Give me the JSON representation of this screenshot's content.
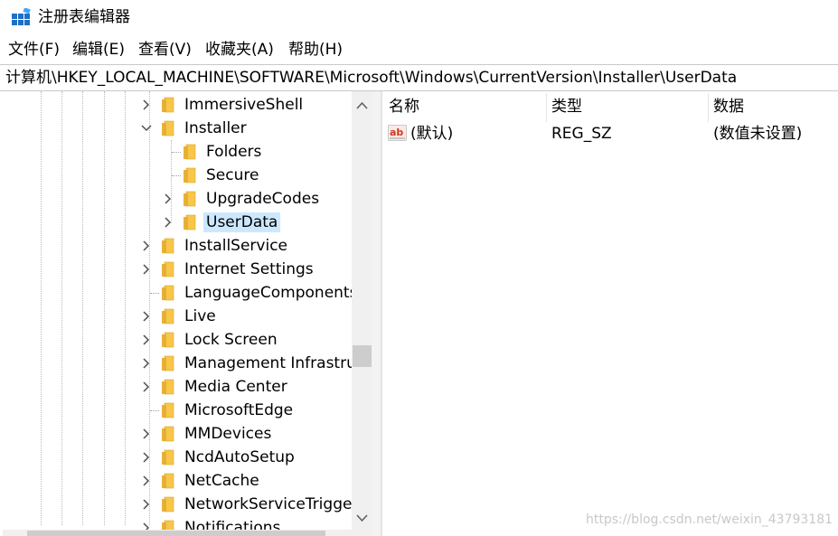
{
  "window": {
    "title": "注册表编辑器",
    "icon": "registry-editor-icon"
  },
  "menu": [
    {
      "label": "文件(F)"
    },
    {
      "label": "编辑(E)"
    },
    {
      "label": "查看(V)"
    },
    {
      "label": "收藏夹(A)"
    },
    {
      "label": "帮助(H)"
    }
  ],
  "address": {
    "path": "计算机\\HKEY_LOCAL_MACHINE\\SOFTWARE\\Microsoft\\Windows\\CurrentVersion\\Installer\\UserData"
  },
  "tree": {
    "items": [
      {
        "label": "ImmersiveShell",
        "level": 0,
        "expander": "collapsed"
      },
      {
        "label": "Installer",
        "level": 0,
        "expander": "expanded"
      },
      {
        "label": "Folders",
        "level": 1,
        "expander": "none"
      },
      {
        "label": "Secure",
        "level": 1,
        "expander": "none"
      },
      {
        "label": "UpgradeCodes",
        "level": 1,
        "expander": "collapsed"
      },
      {
        "label": "UserData",
        "level": 1,
        "expander": "collapsed",
        "selected": true
      },
      {
        "label": "InstallService",
        "level": 0,
        "expander": "collapsed"
      },
      {
        "label": "Internet Settings",
        "level": 0,
        "expander": "collapsed"
      },
      {
        "label": "LanguageComponentsInstaller",
        "level": 0,
        "expander": "none"
      },
      {
        "label": "Live",
        "level": 0,
        "expander": "collapsed"
      },
      {
        "label": "Lock Screen",
        "level": 0,
        "expander": "collapsed"
      },
      {
        "label": "Management Infrastructure",
        "level": 0,
        "expander": "collapsed"
      },
      {
        "label": "Media Center",
        "level": 0,
        "expander": "collapsed"
      },
      {
        "label": "MicrosoftEdge",
        "level": 0,
        "expander": "none"
      },
      {
        "label": "MMDevices",
        "level": 0,
        "expander": "collapsed"
      },
      {
        "label": "NcdAutoSetup",
        "level": 0,
        "expander": "collapsed"
      },
      {
        "label": "NetCache",
        "level": 0,
        "expander": "collapsed"
      },
      {
        "label": "NetworkServiceTriggers",
        "level": 0,
        "expander": "collapsed"
      },
      {
        "label": "Notifications",
        "level": 0,
        "expander": "collapsed"
      }
    ],
    "scrollbar": {
      "position": 0.62,
      "visible_fraction": 0.05
    }
  },
  "values": {
    "columns": {
      "name": "名称",
      "type": "类型",
      "data": "数据"
    },
    "rows": [
      {
        "name": "(默认)",
        "type": "REG_SZ",
        "data": "(数值未设置)",
        "icon": "string-value-icon"
      }
    ]
  },
  "watermark": "https://blog.csdn.net/weixin_43793181",
  "colors": {
    "selection": "#cce8ff",
    "folder": "#f7c64a",
    "icon_blue": "#1f6fc5"
  }
}
